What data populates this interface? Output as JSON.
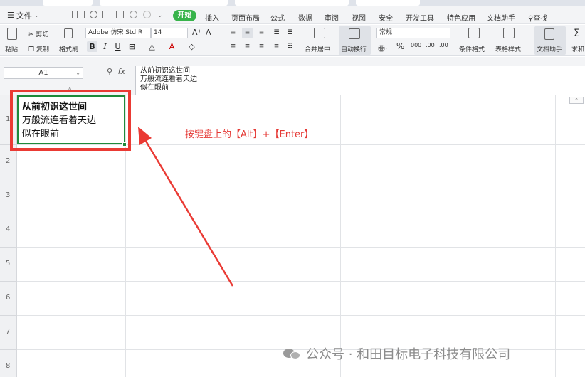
{
  "menubar": {
    "file_label": "文件",
    "start_label": "开始",
    "items": [
      "插入",
      "页面布局",
      "公式",
      "数据",
      "审阅",
      "视图",
      "安全",
      "开发工具",
      "特色应用",
      "文档助手",
      "查找"
    ]
  },
  "ribbon": {
    "paste_label": "粘贴",
    "cut_label": "剪切",
    "copy_label": "复制",
    "format_painter_label": "格式刷",
    "font_name": "Adobe 仿宋 Std R",
    "font_size": "14",
    "merge_label": "合并居中",
    "wrap_label": "自动换行",
    "number_format": "常规",
    "cond_format_label": "条件格式",
    "table_style_label": "表格样式",
    "doc_assistant_label": "文档助手",
    "sum_label": "求和"
  },
  "formula_bar": {
    "cell_ref": "A1",
    "fx_label": "fx",
    "content_lines": [
      "从前初识这世间",
      "万般流连看着天边",
      "似在眼前"
    ]
  },
  "grid": {
    "column_a_label": "A",
    "row_numbers": [
      "1",
      "2",
      "3",
      "4",
      "5",
      "6",
      "7",
      "8"
    ],
    "cell_a1_lines": [
      "从前初识这世间",
      "万般流连看着天边",
      "似在眼前"
    ]
  },
  "annotation": {
    "text": "按键盘上的【Alt】+【Enter】",
    "color": "#e53935"
  },
  "watermark": {
    "text": "公众号 · 和田目标电子科技有限公司"
  },
  "colors": {
    "accent_green": "#37b34a",
    "selection_green": "#1e8a3a",
    "highlight_red": "#ea3a34"
  }
}
